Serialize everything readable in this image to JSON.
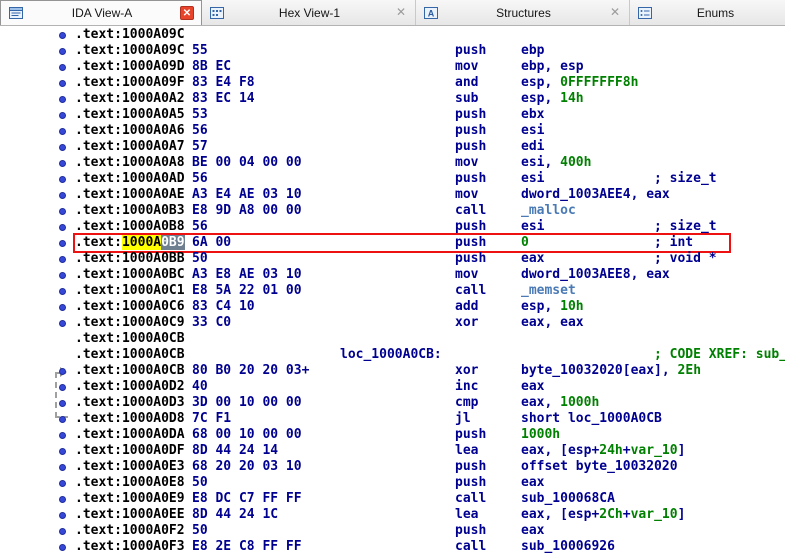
{
  "glyphs": {
    "close": "✕"
  },
  "colors": {
    "addr": "#000000",
    "bytes": "#000090",
    "insn": "#000090",
    "num": "#008000",
    "libfunc": "#4a7ab5",
    "comment": "#000090",
    "xref": "#008000",
    "label": "#000090",
    "hl-yellow": "#ffff00",
    "hl-sel-bg": "#6e7f8f",
    "hl-sel-fg": "#ffffff",
    "box": "#ee1111",
    "dot": "#3748d8",
    "close-red": "#e8442c"
  },
  "tabs": [
    {
      "label": "IDA View-A",
      "icon": "ida-view-icon",
      "active": true,
      "close": "red"
    },
    {
      "label": "Hex View-1",
      "icon": "hex-view-icon",
      "active": false,
      "close": "gray"
    },
    {
      "label": "Structures",
      "icon": "structures-icon",
      "active": false,
      "close": "gray"
    },
    {
      "label": "Enums",
      "icon": "enums-icon",
      "active": false,
      "close": "none"
    }
  ],
  "listing": {
    "lines": [
      {
        "addr": ".text:1000A09C",
        "dot": true
      },
      {
        "addr": ".text:1000A09C",
        "dot": true,
        "bytes": "55",
        "mn": "push",
        "ops": [
          {
            "t": "ebp",
            "c": "i"
          }
        ]
      },
      {
        "addr": ".text:1000A09D",
        "dot": true,
        "bytes": "8B EC",
        "mn": "mov",
        "ops": [
          {
            "t": "ebp, esp",
            "c": "i"
          }
        ]
      },
      {
        "addr": ".text:1000A09F",
        "dot": true,
        "bytes": "83 E4 F8",
        "mn": "and",
        "ops": [
          {
            "t": "esp, ",
            "c": "i"
          },
          {
            "t": "0FFFFFFF8h",
            "c": "n"
          }
        ]
      },
      {
        "addr": ".text:1000A0A2",
        "dot": true,
        "bytes": "83 EC 14",
        "mn": "sub",
        "ops": [
          {
            "t": "esp, ",
            "c": "i"
          },
          {
            "t": "14h",
            "c": "n"
          }
        ]
      },
      {
        "addr": ".text:1000A0A5",
        "dot": true,
        "bytes": "53",
        "mn": "push",
        "ops": [
          {
            "t": "ebx",
            "c": "i"
          }
        ]
      },
      {
        "addr": ".text:1000A0A6",
        "dot": true,
        "bytes": "56",
        "mn": "push",
        "ops": [
          {
            "t": "esi",
            "c": "i"
          }
        ]
      },
      {
        "addr": ".text:1000A0A7",
        "dot": true,
        "bytes": "57",
        "mn": "push",
        "ops": [
          {
            "t": "edi",
            "c": "i"
          }
        ]
      },
      {
        "addr": ".text:1000A0A8",
        "dot": true,
        "bytes": "BE 00 04 00 00",
        "mn": "mov",
        "ops": [
          {
            "t": "esi, ",
            "c": "i"
          },
          {
            "t": "400h",
            "c": "n"
          }
        ]
      },
      {
        "addr": ".text:1000A0AD",
        "dot": true,
        "bytes": "56",
        "mn": "push",
        "ops": [
          {
            "t": "esi",
            "c": "i"
          }
        ],
        "cmt": {
          "t": "; size_t",
          "c": "c"
        }
      },
      {
        "addr": ".text:1000A0AE",
        "dot": true,
        "bytes": "A3 E4 AE 03 10",
        "mn": "mov",
        "ops": [
          {
            "t": "dword_1003AEE4, eax",
            "c": "i"
          }
        ]
      },
      {
        "addr": ".text:1000A0B3",
        "dot": true,
        "bytes": "E8 9D A8 00 00",
        "mn": "call",
        "ops": [
          {
            "t": "_malloc",
            "c": "f"
          }
        ]
      },
      {
        "addr": ".text:1000A0B8",
        "dot": true,
        "bytes": "56",
        "mn": "push",
        "ops": [
          {
            "t": "esi",
            "c": "i"
          }
        ],
        "cmt": {
          "t": "; size_t",
          "c": "c"
        }
      },
      {
        "addr_segs": [
          {
            "t": ".text:"
          },
          {
            "t": "1000A",
            "bg": "y"
          },
          {
            "t": "0B9",
            "bg": "s"
          }
        ],
        "dot": true,
        "bytes": "6A 00",
        "mn": "push",
        "ops": [
          {
            "t": "0",
            "c": "n"
          }
        ],
        "cmt": {
          "t": "; int",
          "c": "c"
        },
        "boxed": true
      },
      {
        "addr": ".text:1000A0BB",
        "dot": true,
        "bytes": "50",
        "mn": "push",
        "ops": [
          {
            "t": "eax",
            "c": "i"
          }
        ],
        "cmt": {
          "t": "; void *",
          "c": "c"
        }
      },
      {
        "addr": ".text:1000A0BC",
        "dot": true,
        "bytes": "A3 E8 AE 03 10",
        "mn": "mov",
        "ops": [
          {
            "t": "dword_1003AEE8, eax",
            "c": "i"
          }
        ]
      },
      {
        "addr": ".text:1000A0C1",
        "dot": true,
        "bytes": "E8 5A 22 01 00",
        "mn": "call",
        "ops": [
          {
            "t": "_memset",
            "c": "f"
          }
        ]
      },
      {
        "addr": ".text:1000A0C6",
        "dot": true,
        "bytes": "83 C4 10",
        "mn": "add",
        "ops": [
          {
            "t": "esp, ",
            "c": "i"
          },
          {
            "t": "10h",
            "c": "n"
          }
        ]
      },
      {
        "addr": ".text:1000A0C9",
        "dot": true,
        "bytes": "33 C0",
        "mn": "xor",
        "ops": [
          {
            "t": "eax, eax",
            "c": "i"
          }
        ]
      },
      {
        "addr": ".text:1000A0CB"
      },
      {
        "addr": ".text:1000A0CB",
        "label": "loc_1000A0CB:",
        "cmt": {
          "t": "; CODE XREF: sub_",
          "c": "x"
        }
      },
      {
        "addr": ".text:1000A0CB",
        "dot": true,
        "bytes": "80 B0 20 20 03+",
        "mn": "xor",
        "ops": [
          {
            "t": "byte_10032020[eax], ",
            "c": "i"
          },
          {
            "t": "2Eh",
            "c": "n"
          }
        ]
      },
      {
        "addr": ".text:1000A0D2",
        "dot": true,
        "bytes": "40",
        "mn": "inc",
        "ops": [
          {
            "t": "eax",
            "c": "i"
          }
        ]
      },
      {
        "addr": ".text:1000A0D3",
        "dot": true,
        "bytes": "3D 00 10 00 00",
        "mn": "cmp",
        "ops": [
          {
            "t": "eax, ",
            "c": "i"
          },
          {
            "t": "1000h",
            "c": "n"
          }
        ]
      },
      {
        "addr": ".text:1000A0D8",
        "dot": true,
        "bytes": "7C F1",
        "mn": "jl",
        "ops": [
          {
            "t": "short loc_1000A0CB",
            "c": "i"
          }
        ]
      },
      {
        "addr": ".text:1000A0DA",
        "dot": true,
        "bytes": "68 00 10 00 00",
        "mn": "push",
        "ops": [
          {
            "t": "1000h",
            "c": "n"
          }
        ]
      },
      {
        "addr": ".text:1000A0DF",
        "dot": true,
        "bytes": "8D 44 24 14",
        "mn": "lea",
        "ops": [
          {
            "t": "eax, [esp+",
            "c": "i"
          },
          {
            "t": "24h",
            "c": "n"
          },
          {
            "t": "+",
            "c": "i"
          },
          {
            "t": "var_10",
            "c": "n"
          },
          {
            "t": "]",
            "c": "i"
          }
        ]
      },
      {
        "addr": ".text:1000A0E3",
        "dot": true,
        "bytes": "68 20 20 03 10",
        "mn": "push",
        "ops": [
          {
            "t": "offset byte_10032020",
            "c": "i"
          }
        ]
      },
      {
        "addr": ".text:1000A0E8",
        "dot": true,
        "bytes": "50",
        "mn": "push",
        "ops": [
          {
            "t": "eax",
            "c": "i"
          }
        ]
      },
      {
        "addr": ".text:1000A0E9",
        "dot": true,
        "bytes": "E8 DC C7 FF FF",
        "mn": "call",
        "ops": [
          {
            "t": "sub_100068CA",
            "c": "i"
          }
        ]
      },
      {
        "addr": ".text:1000A0EE",
        "dot": true,
        "bytes": "8D 44 24 1C",
        "mn": "lea",
        "ops": [
          {
            "t": "eax, [esp+",
            "c": "i"
          },
          {
            "t": "2Ch",
            "c": "n"
          },
          {
            "t": "+",
            "c": "i"
          },
          {
            "t": "var_10",
            "c": "n"
          },
          {
            "t": "]",
            "c": "i"
          }
        ]
      },
      {
        "addr": ".text:1000A0F2",
        "dot": true,
        "bytes": "50",
        "mn": "push",
        "ops": [
          {
            "t": "eax",
            "c": "i"
          }
        ]
      },
      {
        "addr": ".text:1000A0F3",
        "dot": true,
        "bytes": "E8 2E C8 FF FF",
        "mn": "call",
        "ops": [
          {
            "t": "sub_10006926",
            "c": "i"
          }
        ]
      }
    ]
  }
}
